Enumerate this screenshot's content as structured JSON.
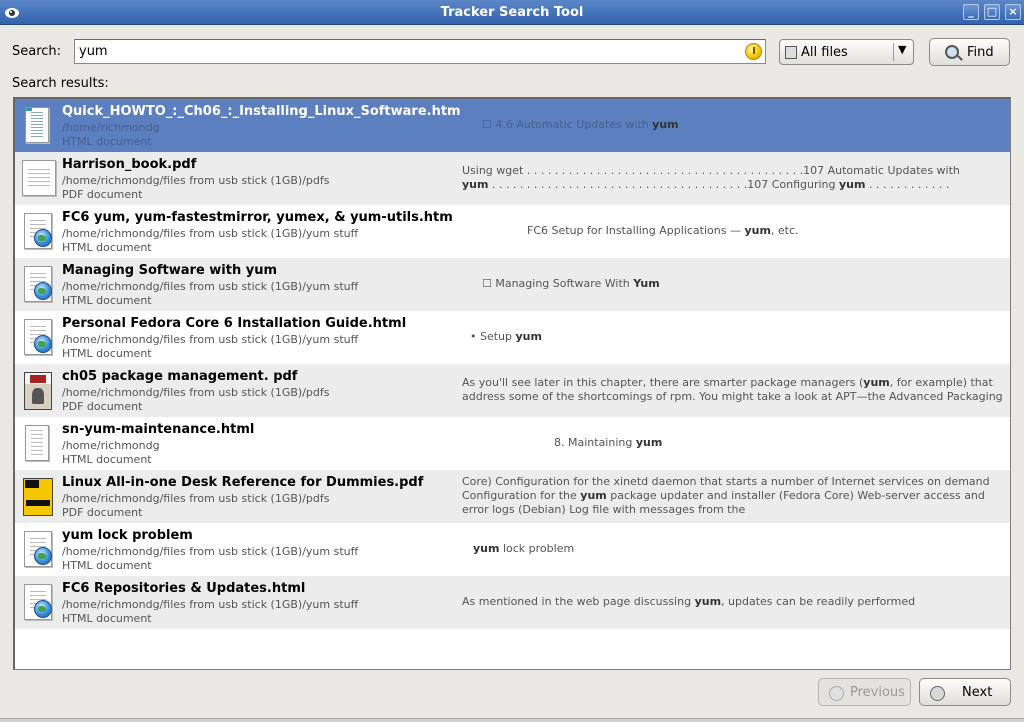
{
  "window": {
    "title": "Tracker Search Tool",
    "buttons": [
      "_",
      "□",
      "×"
    ]
  },
  "search": {
    "label": "Search:",
    "value": "yum",
    "filter_selected": "All files",
    "find_label": "Find"
  },
  "results_label": "Search results:",
  "results": [
    {
      "name": "Quick_HOWTO_:_Ch06_:_Installing_Linux_Software.htm",
      "path": "/home/richmondg",
      "type": "HTML document",
      "snippet_pre": "☐ 4.6 Automatic Updates with ",
      "snippet_hit": "yum",
      "snippet_post": "",
      "icon": "text-page-icon",
      "selected": true
    },
    {
      "name": "Harrison_book.pdf",
      "path": "/home/richmondg/files from usb stick (1GB)/pdfs",
      "type": "PDF document",
      "snippet_line1": "Using wget . . . . . . . . . . . . . . . . . . . . . . . . . . . . . . . . . . . . . . . .107 Automatic Updates with",
      "snippet_line2_hit": "yum",
      "snippet_line2": " . . . . . . . . . . . . . . . . . . . . . . . . . . . . . . . . . . . . .107 Configuring ",
      "snippet_line2_hit2": "yum",
      "snippet_line2_post": " . . . . . . . . . . . .",
      "icon": "pdf-page-icon"
    },
    {
      "name": "FC6 yum, yum-fastestmirror, yumex, & yum-utils.htm",
      "path": "/home/richmondg/files from usb stick (1GB)/yum stuff",
      "type": "HTML document",
      "snippet_pre": "FC6 Setup for Installing Applications — ",
      "snippet_hit": "yum",
      "snippet_post": ", etc.",
      "icon": "html-globe-icon"
    },
    {
      "name": "Managing Software with yum",
      "path": "/home/richmondg/files from usb stick (1GB)/yum stuff",
      "type": "HTML document",
      "snippet_pre": "☐ Managing Software With ",
      "snippet_hit": "Yum",
      "snippet_post": "",
      "icon": "html-globe-icon"
    },
    {
      "name": "Personal Fedora Core 6 Installation Guide.html",
      "path": "/home/richmondg/files from usb stick (1GB)/yum stuff",
      "type": "HTML document",
      "snippet_pre": "• Setup ",
      "snippet_hit": "yum",
      "snippet_post": "",
      "icon": "html-globe-icon"
    },
    {
      "name": "ch05 package management. pdf",
      "path": "/home/richmondg/files from usb stick (1GB)/pdfs",
      "type": "PDF document",
      "snippet_line1_pre": "As you'll see later in this chapter, there are smarter package managers (",
      "snippet_line1_hit": "yum",
      "snippet_line1_post": ", for example) that",
      "snippet_line2": "address some of the shortcomings of rpm. You might take a look at APT—the Advanced Packaging",
      "icon": "book-cover-icon"
    },
    {
      "name": "sn-yum-maintenance.html",
      "path": "/home/richmondg",
      "type": "HTML document",
      "snippet_pre": "8. Maintaining ",
      "snippet_hit": "yum",
      "snippet_post": "",
      "icon": "text-page-icon"
    },
    {
      "name": "Linux All-in-one Desk Reference for Dummies.pdf",
      "path": "/home/richmondg/files from usb stick (1GB)/pdfs",
      "type": "PDF document",
      "snippet_line1": "Core) Configuration for the xinetd daemon that starts a number of Internet services on demand",
      "snippet_line2_pre": "Configuration for the ",
      "snippet_line2_hit": "yum",
      "snippet_line2_post": " package updater and installer (Fedora Core) Web-server access and",
      "snippet_line3": "error logs (Debian) Log file with messages from the",
      "icon": "dummies-cover-icon"
    },
    {
      "name": "yum lock problem",
      "path": "/home/richmondg/files from usb stick (1GB)/yum stuff",
      "type": "HTML document",
      "snippet_pre": "",
      "snippet_hit": "yum",
      "snippet_post": " lock problem",
      "icon": "html-globe-icon"
    },
    {
      "name": "FC6 Repositories & Updates.html",
      "path": "/home/richmondg/files from usb stick (1GB)/yum stuff",
      "type": "HTML document",
      "snippet_pre": "As mentioned in the web page discussing ",
      "snippet_hit": "yum",
      "snippet_post": ", updates can be readily performed",
      "icon": "html-globe-icon"
    }
  ],
  "nav": {
    "previous_label": "Previous",
    "next_label": "Next"
  }
}
